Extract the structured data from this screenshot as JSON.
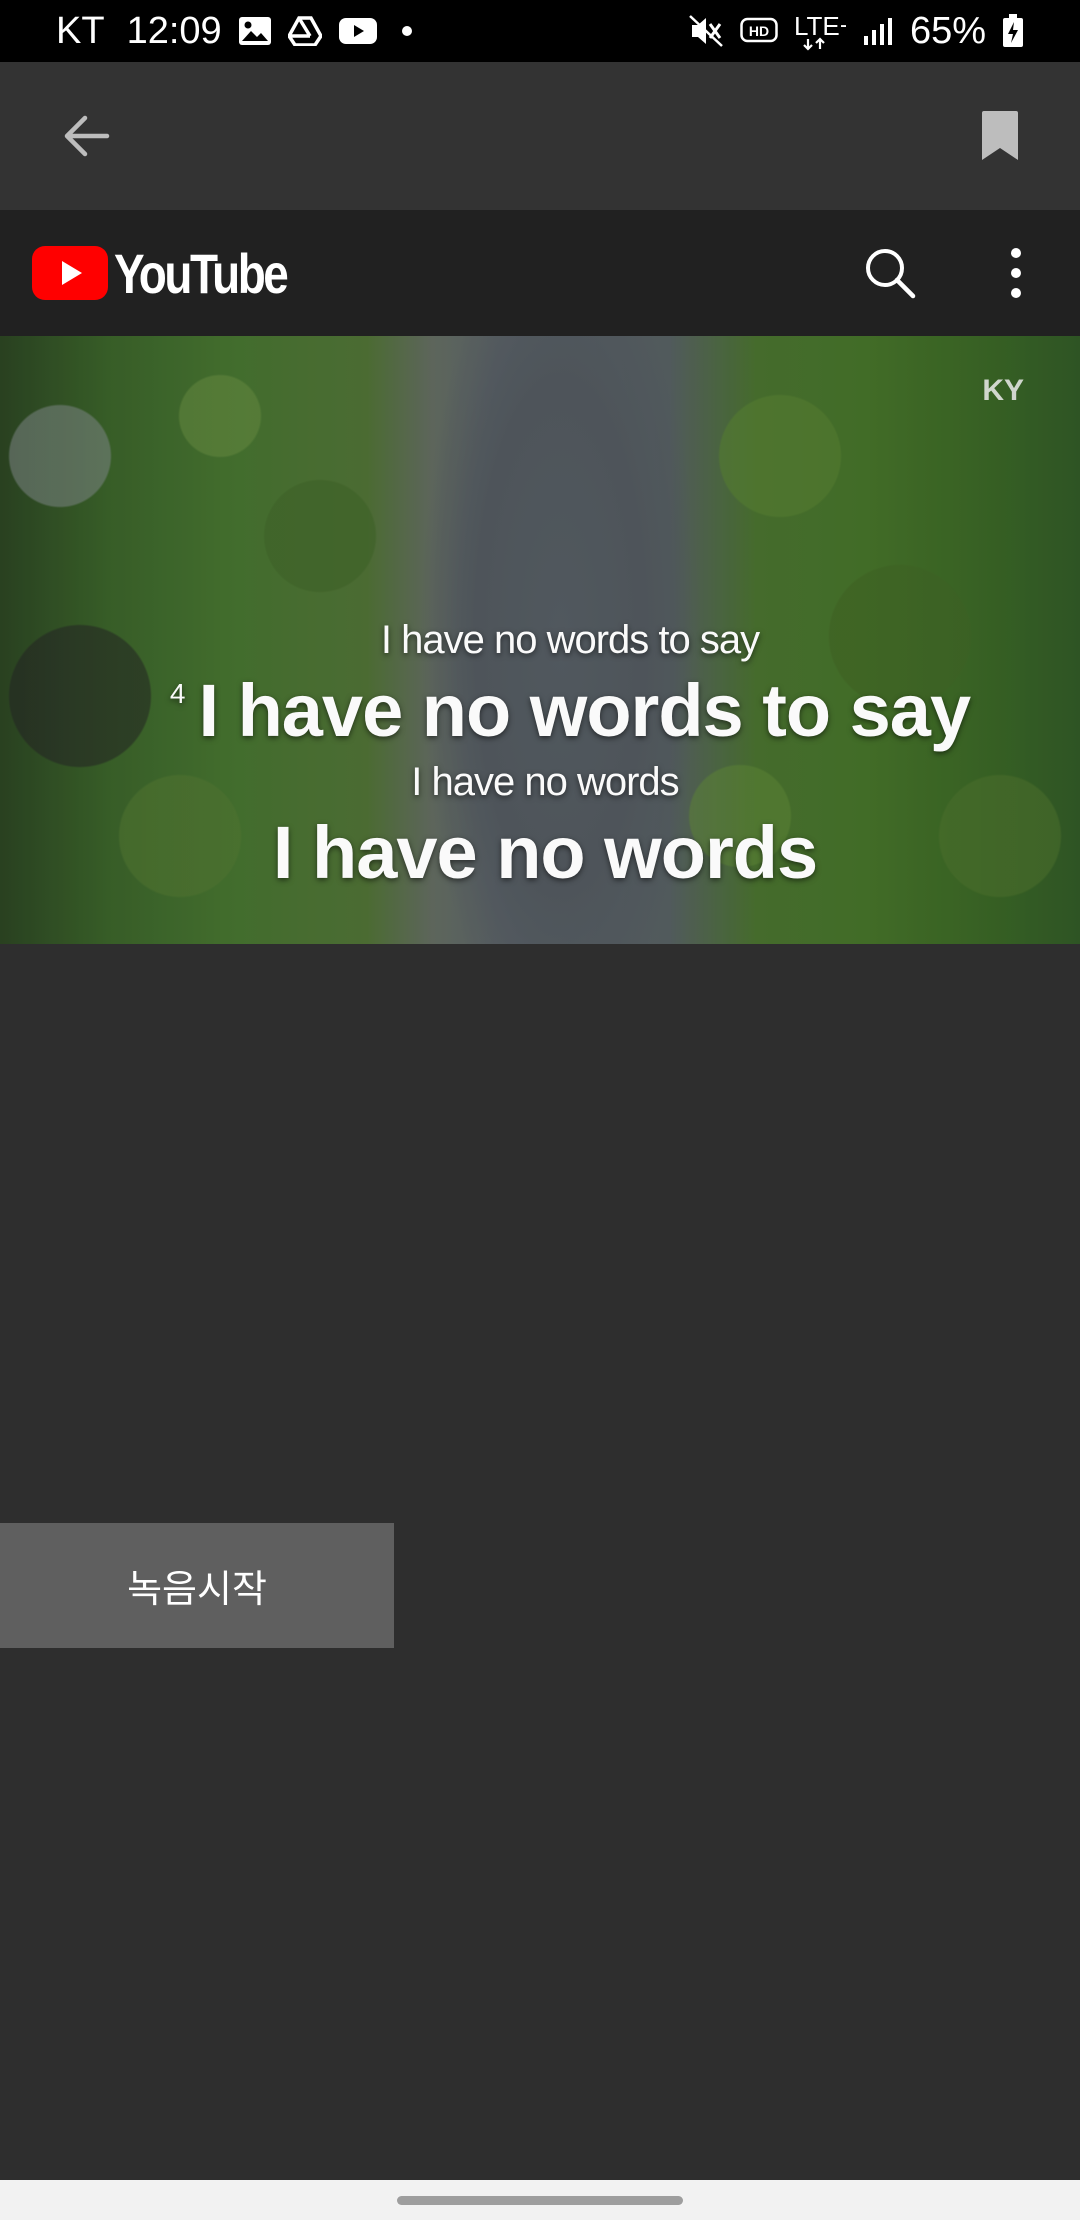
{
  "status_bar": {
    "carrier": "KT",
    "time": "12:09",
    "icons_left": [
      "gallery-icon",
      "drive-icon",
      "youtube-notify-icon",
      "more-dot-icon"
    ],
    "icons_right": [
      "mute-vibrate-icon",
      "hd-voice-icon",
      "lte-plus-icon",
      "signal-icon"
    ],
    "network": "LTE+",
    "battery_percent": "65%"
  },
  "app_bar": {
    "back_icon": "arrow-back-icon",
    "bookmark_icon": "bookmark-icon"
  },
  "youtube": {
    "logo_text": "YouTube",
    "brand_red": "#FF0000",
    "search_icon": "search-icon",
    "more_icon": "more-vert-icon"
  },
  "video": {
    "watermark": "KY",
    "lyric_line_1": "I have no words to say",
    "lyric_line_2_number": "4",
    "lyric_line_2": "I have no words to say",
    "lyric_line_3": "I have no words",
    "lyric_line_4": "I have no words"
  },
  "record_button": {
    "label": "녹음시작"
  },
  "colors": {
    "background": "#2e2e2e",
    "app_bar": "#333333",
    "youtube_header": "#212121",
    "record_button": "#5f5f5f"
  }
}
